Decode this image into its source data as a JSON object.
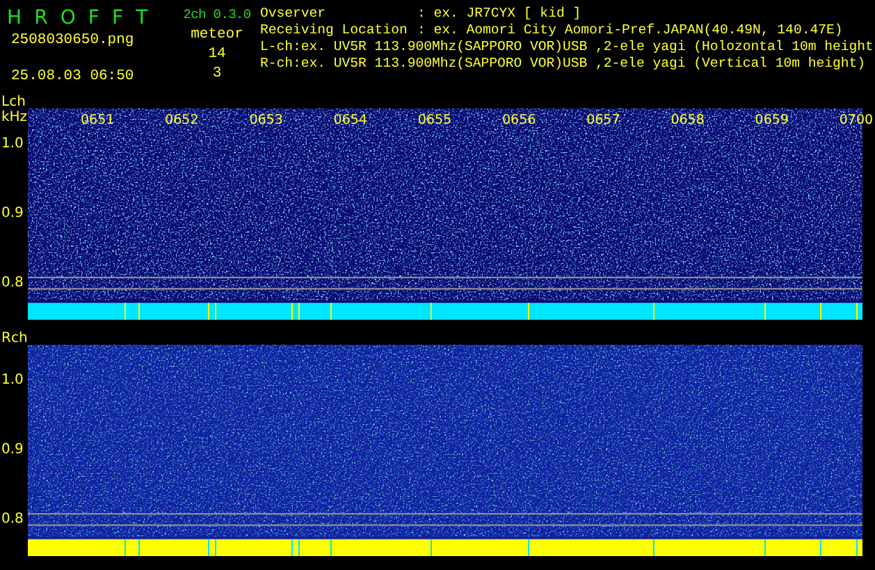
{
  "app": {
    "title": "H R O F F T",
    "version": "2ch 0.3.0",
    "file": "2508030650.png",
    "datetime": "25.08.03 06:50"
  },
  "meteor": {
    "label": "meteor",
    "counts": [
      "14",
      "3"
    ]
  },
  "info": [
    {
      "kind": "field",
      "label": "Ovserver",
      "value": ": ex. JR7CYX [ kid ]"
    },
    {
      "kind": "field",
      "label": "Receiving Location",
      "value": ": ex. Aomori City Aomori-Pref.JAPAN(40.49N, 140.47E)"
    },
    {
      "kind": "line",
      "text": "L-ch:ex. UV5R 113.900Mhz(SAPPORO VOR)USB ,2-ele yagi (Holozontal 10m height"
    },
    {
      "kind": "line",
      "text": "R-ch:ex. UV5R 113.900Mhz(SAPPORO VOR)USB ,2-ele yagi (Vertical 10m height)"
    }
  ],
  "channels": [
    {
      "kind": "quiet",
      "label": "Lch",
      "unit": "kHz",
      "ticks": [
        "1.0",
        "0.9",
        "0.8"
      ],
      "times": [
        "0651",
        "0652",
        "0653",
        "0654",
        "0655",
        "0656",
        "0657",
        "0658",
        "0659",
        "0700"
      ]
    },
    {
      "kind": "busy",
      "label": "Rch",
      "ticks": [
        "1.0",
        "0.9",
        "0.8"
      ]
    }
  ]
}
